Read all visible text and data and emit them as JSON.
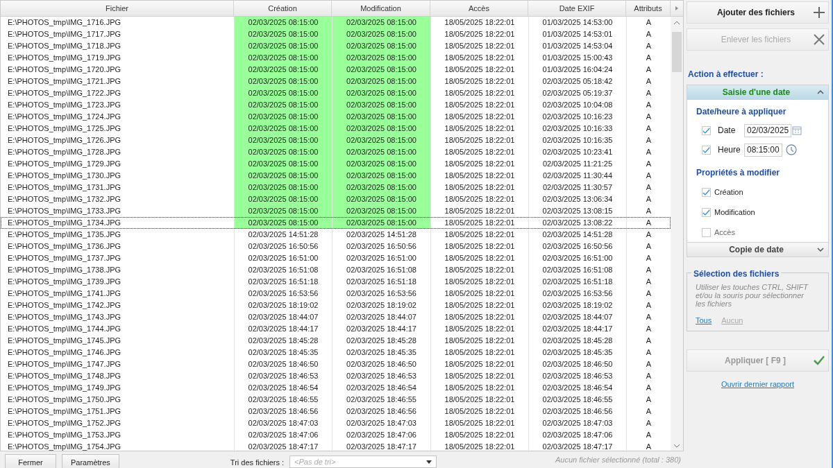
{
  "table": {
    "columns": [
      "Fichier",
      "Création",
      "Modification",
      "Accès",
      "Date EXIF",
      "Attributs"
    ],
    "rows": [
      {
        "file": "E:\\PHOTOS_tmp\\IMG_1716.JPG",
        "creation": "02/03/2025 08:15:00",
        "modification": "02/03/2025 08:15:00",
        "access": "18/05/2025 18:22:01",
        "exif": "01/03/2025 14:53:00",
        "attributes": "A",
        "changed": true,
        "focused": false
      },
      {
        "file": "E:\\PHOTOS_tmp\\IMG_1717.JPG",
        "creation": "02/03/2025 08:15:00",
        "modification": "02/03/2025 08:15:00",
        "access": "18/05/2025 18:22:01",
        "exif": "01/03/2025 14:53:01",
        "attributes": "A",
        "changed": true,
        "focused": false
      },
      {
        "file": "E:\\PHOTOS_tmp\\IMG_1718.JPG",
        "creation": "02/03/2025 08:15:00",
        "modification": "02/03/2025 08:15:00",
        "access": "18/05/2025 18:22:01",
        "exif": "01/03/2025 14:53:04",
        "attributes": "A",
        "changed": true,
        "focused": false
      },
      {
        "file": "E:\\PHOTOS_tmp\\IMG_1719.JPG",
        "creation": "02/03/2025 08:15:00",
        "modification": "02/03/2025 08:15:00",
        "access": "18/05/2025 18:22:01",
        "exif": "01/03/2025 15:00:43",
        "attributes": "A",
        "changed": true,
        "focused": false
      },
      {
        "file": "E:\\PHOTOS_tmp\\IMG_1720.JPG",
        "creation": "02/03/2025 08:15:00",
        "modification": "02/03/2025 08:15:00",
        "access": "18/05/2025 18:22:01",
        "exif": "01/03/2025 16:04:24",
        "attributes": "A",
        "changed": true,
        "focused": false
      },
      {
        "file": "E:\\PHOTOS_tmp\\IMG_1721.JPG",
        "creation": "02/03/2025 08:15:00",
        "modification": "02/03/2025 08:15:00",
        "access": "18/05/2025 18:22:01",
        "exif": "02/03/2025 05:18:42",
        "attributes": "A",
        "changed": true,
        "focused": false
      },
      {
        "file": "E:\\PHOTOS_tmp\\IMG_1722.JPG",
        "creation": "02/03/2025 08:15:00",
        "modification": "02/03/2025 08:15:00",
        "access": "18/05/2025 18:22:01",
        "exif": "02/03/2025 05:19:37",
        "attributes": "A",
        "changed": true,
        "focused": false
      },
      {
        "file": "E:\\PHOTOS_tmp\\IMG_1723.JPG",
        "creation": "02/03/2025 08:15:00",
        "modification": "02/03/2025 08:15:00",
        "access": "18/05/2025 18:22:01",
        "exif": "02/03/2025 10:04:08",
        "attributes": "A",
        "changed": true,
        "focused": false
      },
      {
        "file": "E:\\PHOTOS_tmp\\IMG_1724.JPG",
        "creation": "02/03/2025 08:15:00",
        "modification": "02/03/2025 08:15:00",
        "access": "18/05/2025 18:22:01",
        "exif": "02/03/2025 10:16:23",
        "attributes": "A",
        "changed": true,
        "focused": false
      },
      {
        "file": "E:\\PHOTOS_tmp\\IMG_1725.JPG",
        "creation": "02/03/2025 08:15:00",
        "modification": "02/03/2025 08:15:00",
        "access": "18/05/2025 18:22:01",
        "exif": "02/03/2025 10:16:33",
        "attributes": "A",
        "changed": true,
        "focused": false
      },
      {
        "file": "E:\\PHOTOS_tmp\\IMG_1726.JPG",
        "creation": "02/03/2025 08:15:00",
        "modification": "02/03/2025 08:15:00",
        "access": "18/05/2025 18:22:01",
        "exif": "02/03/2025 10:16:35",
        "attributes": "A",
        "changed": true,
        "focused": false
      },
      {
        "file": "E:\\PHOTOS_tmp\\IMG_1728.JPG",
        "creation": "02/03/2025 08:15:00",
        "modification": "02/03/2025 08:15:00",
        "access": "18/05/2025 18:22:01",
        "exif": "02/03/2025 10:23:41",
        "attributes": "A",
        "changed": true,
        "focused": false
      },
      {
        "file": "E:\\PHOTOS_tmp\\IMG_1729.JPG",
        "creation": "02/03/2025 08:15:00",
        "modification": "02/03/2025 08:15:00",
        "access": "18/05/2025 18:22:01",
        "exif": "02/03/2025 11:21:25",
        "attributes": "A",
        "changed": true,
        "focused": false
      },
      {
        "file": "E:\\PHOTOS_tmp\\IMG_1730.JPG",
        "creation": "02/03/2025 08:15:00",
        "modification": "02/03/2025 08:15:00",
        "access": "18/05/2025 18:22:01",
        "exif": "02/03/2025 11:30:44",
        "attributes": "A",
        "changed": true,
        "focused": false
      },
      {
        "file": "E:\\PHOTOS_tmp\\IMG_1731.JPG",
        "creation": "02/03/2025 08:15:00",
        "modification": "02/03/2025 08:15:00",
        "access": "18/05/2025 18:22:01",
        "exif": "02/03/2025 11:30:57",
        "attributes": "A",
        "changed": true,
        "focused": false
      },
      {
        "file": "E:\\PHOTOS_tmp\\IMG_1732.JPG",
        "creation": "02/03/2025 08:15:00",
        "modification": "02/03/2025 08:15:00",
        "access": "18/05/2025 18:22:01",
        "exif": "02/03/2025 13:06:34",
        "attributes": "A",
        "changed": true,
        "focused": false
      },
      {
        "file": "E:\\PHOTOS_tmp\\IMG_1733.JPG",
        "creation": "02/03/2025 08:15:00",
        "modification": "02/03/2025 08:15:00",
        "access": "18/05/2025 18:22:01",
        "exif": "02/03/2025 13:08:15",
        "attributes": "A",
        "changed": true,
        "focused": false
      },
      {
        "file": "E:\\PHOTOS_tmp\\IMG_1734.JPG",
        "creation": "02/03/2025 08:15:00",
        "modification": "02/03/2025 08:15:00",
        "access": "18/05/2025 18:22:01",
        "exif": "02/03/2025 13:08:22",
        "attributes": "A",
        "changed": true,
        "focused": true
      },
      {
        "file": "E:\\PHOTOS_tmp\\IMG_1735.JPG",
        "creation": "02/03/2025 14:51:28",
        "modification": "02/03/2025 14:51:28",
        "access": "18/05/2025 18:22:01",
        "exif": "02/03/2025 14:51:28",
        "attributes": "A",
        "changed": false,
        "focused": false
      },
      {
        "file": "E:\\PHOTOS_tmp\\IMG_1736.JPG",
        "creation": "02/03/2025 16:50:56",
        "modification": "02/03/2025 16:50:56",
        "access": "18/05/2025 18:22:01",
        "exif": "02/03/2025 16:50:56",
        "attributes": "A",
        "changed": false,
        "focused": false
      },
      {
        "file": "E:\\PHOTOS_tmp\\IMG_1737.JPG",
        "creation": "02/03/2025 16:51:00",
        "modification": "02/03/2025 16:51:00",
        "access": "18/05/2025 18:22:01",
        "exif": "02/03/2025 16:51:00",
        "attributes": "A",
        "changed": false,
        "focused": false
      },
      {
        "file": "E:\\PHOTOS_tmp\\IMG_1738.JPG",
        "creation": "02/03/2025 16:51:08",
        "modification": "02/03/2025 16:51:08",
        "access": "18/05/2025 18:22:01",
        "exif": "02/03/2025 16:51:08",
        "attributes": "A",
        "changed": false,
        "focused": false
      },
      {
        "file": "E:\\PHOTOS_tmp\\IMG_1739.JPG",
        "creation": "02/03/2025 16:51:18",
        "modification": "02/03/2025 16:51:18",
        "access": "18/05/2025 18:22:01",
        "exif": "02/03/2025 16:51:18",
        "attributes": "A",
        "changed": false,
        "focused": false
      },
      {
        "file": "E:\\PHOTOS_tmp\\IMG_1741.JPG",
        "creation": "02/03/2025 16:53:56",
        "modification": "02/03/2025 16:53:56",
        "access": "18/05/2025 18:22:01",
        "exif": "02/03/2025 16:53:56",
        "attributes": "A",
        "changed": false,
        "focused": false
      },
      {
        "file": "E:\\PHOTOS_tmp\\IMG_1742.JPG",
        "creation": "02/03/2025 18:19:02",
        "modification": "02/03/2025 18:19:02",
        "access": "18/05/2025 18:22:01",
        "exif": "02/03/2025 18:19:02",
        "attributes": "A",
        "changed": false,
        "focused": false
      },
      {
        "file": "E:\\PHOTOS_tmp\\IMG_1743.JPG",
        "creation": "02/03/2025 18:44:07",
        "modification": "02/03/2025 18:44:07",
        "access": "18/05/2025 18:22:01",
        "exif": "02/03/2025 18:44:07",
        "attributes": "A",
        "changed": false,
        "focused": false
      },
      {
        "file": "E:\\PHOTOS_tmp\\IMG_1744.JPG",
        "creation": "02/03/2025 18:44:17",
        "modification": "02/03/2025 18:44:17",
        "access": "18/05/2025 18:22:01",
        "exif": "02/03/2025 18:44:17",
        "attributes": "A",
        "changed": false,
        "focused": false
      },
      {
        "file": "E:\\PHOTOS_tmp\\IMG_1745.JPG",
        "creation": "02/03/2025 18:45:28",
        "modification": "02/03/2025 18:45:28",
        "access": "18/05/2025 18:22:01",
        "exif": "02/03/2025 18:45:28",
        "attributes": "A",
        "changed": false,
        "focused": false
      },
      {
        "file": "E:\\PHOTOS_tmp\\IMG_1746.JPG",
        "creation": "02/03/2025 18:45:35",
        "modification": "02/03/2025 18:45:35",
        "access": "18/05/2025 18:22:01",
        "exif": "02/03/2025 18:45:35",
        "attributes": "A",
        "changed": false,
        "focused": false
      },
      {
        "file": "E:\\PHOTOS_tmp\\IMG_1747.JPG",
        "creation": "02/03/2025 18:46:50",
        "modification": "02/03/2025 18:46:50",
        "access": "18/05/2025 18:22:01",
        "exif": "02/03/2025 18:46:50",
        "attributes": "A",
        "changed": false,
        "focused": false
      },
      {
        "file": "E:\\PHOTOS_tmp\\IMG_1748.JPG",
        "creation": "02/03/2025 18:46:53",
        "modification": "02/03/2025 18:46:53",
        "access": "18/05/2025 18:22:01",
        "exif": "02/03/2025 18:46:53",
        "attributes": "A",
        "changed": false,
        "focused": false
      },
      {
        "file": "E:\\PHOTOS_tmp\\IMG_1749.JPG",
        "creation": "02/03/2025 18:46:54",
        "modification": "02/03/2025 18:46:54",
        "access": "18/05/2025 18:22:01",
        "exif": "02/03/2025 18:46:54",
        "attributes": "A",
        "changed": false,
        "focused": false
      },
      {
        "file": "E:\\PHOTOS_tmp\\IMG_1750.JPG",
        "creation": "02/03/2025 18:46:55",
        "modification": "02/03/2025 18:46:55",
        "access": "18/05/2025 18:22:01",
        "exif": "02/03/2025 18:46:55",
        "attributes": "A",
        "changed": false,
        "focused": false
      },
      {
        "file": "E:\\PHOTOS_tmp\\IMG_1751.JPG",
        "creation": "02/03/2025 18:46:56",
        "modification": "02/03/2025 18:46:56",
        "access": "18/05/2025 18:22:01",
        "exif": "02/03/2025 18:46:56",
        "attributes": "A",
        "changed": false,
        "focused": false
      },
      {
        "file": "E:\\PHOTOS_tmp\\IMG_1752.JPG",
        "creation": "02/03/2025 18:47:03",
        "modification": "02/03/2025 18:47:03",
        "access": "18/05/2025 18:22:01",
        "exif": "02/03/2025 18:47:03",
        "attributes": "A",
        "changed": false,
        "focused": false
      },
      {
        "file": "E:\\PHOTOS_tmp\\IMG_1753.JPG",
        "creation": "02/03/2025 18:47:06",
        "modification": "02/03/2025 18:47:06",
        "access": "18/05/2025 18:22:01",
        "exif": "02/03/2025 18:47:06",
        "attributes": "A",
        "changed": false,
        "focused": false
      },
      {
        "file": "E:\\PHOTOS_tmp\\IMG_1754.JPG",
        "creation": "02/03/2025 18:47:17",
        "modification": "02/03/2025 18:47:17",
        "access": "18/05/2025 18:22:01",
        "exif": "02/03/2025 18:47:17",
        "attributes": "A",
        "changed": false,
        "focused": false
      }
    ]
  },
  "bottom_bar": {
    "buttons": [
      "Fermer",
      "Paramètres"
    ],
    "sort_label": "Tri des fichiers :",
    "sort_placeholder": "<Pas de tri>",
    "status": "Aucun fichier sélectionné (total : 380)"
  },
  "side_panel": {
    "add_button": {
      "label": "Ajouter des fichiers",
      "disabled": false
    },
    "remove_button": {
      "label": "Enlever les fichiers",
      "disabled": true
    },
    "action_title": "Action à effectuer :",
    "sections": [
      {
        "title": "Saisie d'une date",
        "expanded": true
      },
      {
        "title": "Copie de date",
        "expanded": false
      }
    ],
    "date_group_title": "Date/heure à appliquer",
    "date_fields": [
      {
        "kind": "date",
        "label": "Date",
        "value": "02/03/2025",
        "checked": true
      },
      {
        "kind": "time",
        "label": "Heure",
        "value": "08:15:00",
        "checked": true
      }
    ],
    "properties_title": "Propriétés à modifier",
    "properties": [
      {
        "label": "Création",
        "checked": true
      },
      {
        "label": "Modification",
        "checked": true
      },
      {
        "label": "Accès",
        "checked": false
      }
    ],
    "selection": {
      "title": "Sélection des fichiers",
      "hint": "Utiliser les touches CTRL, SHIFT et/ou la souris pour sélectionner les fichiers",
      "links": [
        {
          "label": "Tous",
          "disabled": false
        },
        {
          "label": "Aucun",
          "disabled": true
        }
      ]
    },
    "apply_button": {
      "label": "Appliquer [ F9 ]",
      "disabled": true
    },
    "report_link": "Ouvrir dernier rapport"
  }
}
